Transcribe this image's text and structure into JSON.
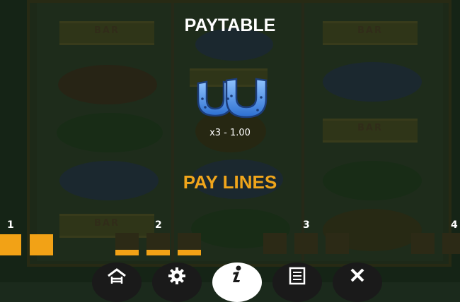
{
  "paytable": {
    "title": "PAYTABLE",
    "symbol_icon": "horseshoe-icon",
    "payout": "x3 - 1.00"
  },
  "paylines": {
    "title": "PAY LINES",
    "lines": [
      {
        "number": "1"
      },
      {
        "number": "2"
      },
      {
        "number": "3"
      },
      {
        "number": "4"
      }
    ]
  },
  "background": {
    "bar_symbol_text": "BAR"
  },
  "menu": {
    "items": [
      {
        "icon": "home-icon"
      },
      {
        "icon": "gear-icon"
      },
      {
        "icon": "info-icon",
        "active": true
      },
      {
        "icon": "scroll-icon"
      },
      {
        "icon": "close-icon"
      }
    ]
  },
  "colors": {
    "accent": "#f0a51b",
    "payline_on": "#f2a216",
    "payline_off": "#2c2a16",
    "horseshoe": "#4d8fe0"
  }
}
